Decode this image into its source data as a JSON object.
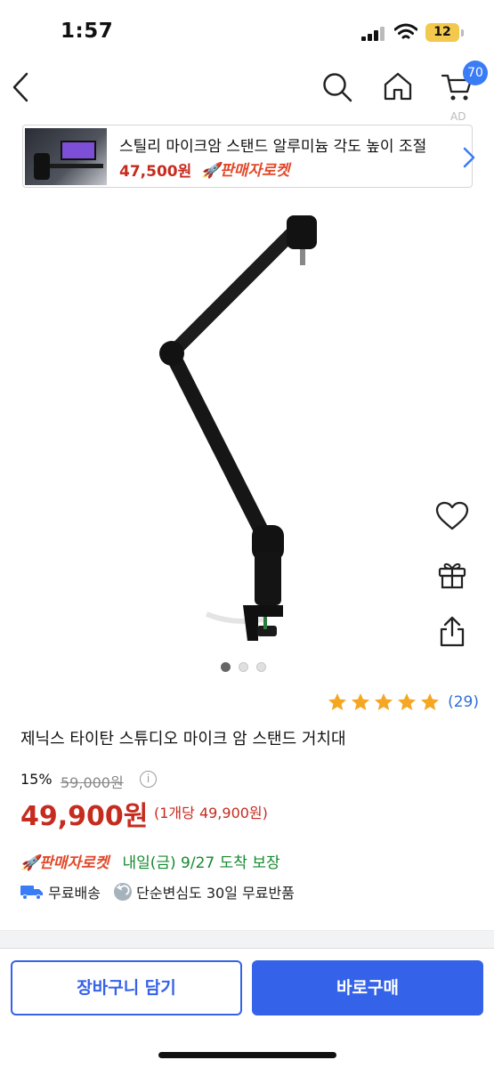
{
  "status_bar": {
    "time": "1:57",
    "battery": "12"
  },
  "nav": {
    "cart_count": "70",
    "ad_mark": "AD"
  },
  "ad_banner": {
    "title": "스틸리 마이크암 스탠드 알루미늄 각도 높이 조절",
    "price": "47,500원",
    "badge": "🚀판매자로켓"
  },
  "product": {
    "image_count": 3,
    "active_image": 1,
    "rating_stars": 5,
    "review_count": "(29)",
    "name": "제닉스 타이탄 스튜디오 마이크 암 스탠드 거치대",
    "discount": "15%",
    "original_price": "59,000원",
    "price": "49,900원",
    "unit_price": "(1개당 49,900원)",
    "delivery_badge": "🚀판매자로켓",
    "arrival": "내일(금) 9/27 도착 보장",
    "free_shipping": "무료배송",
    "free_return": "단순변심도 30일 무료반품"
  },
  "actions": {
    "add_to_cart": "장바구니 담기",
    "buy_now": "바로구매"
  },
  "colors": {
    "accent": "#3462e8",
    "price_red": "#c62b1f",
    "rocket_orange": "#e2482a",
    "arrival_green": "#138a2e",
    "star": "#f5a623"
  }
}
